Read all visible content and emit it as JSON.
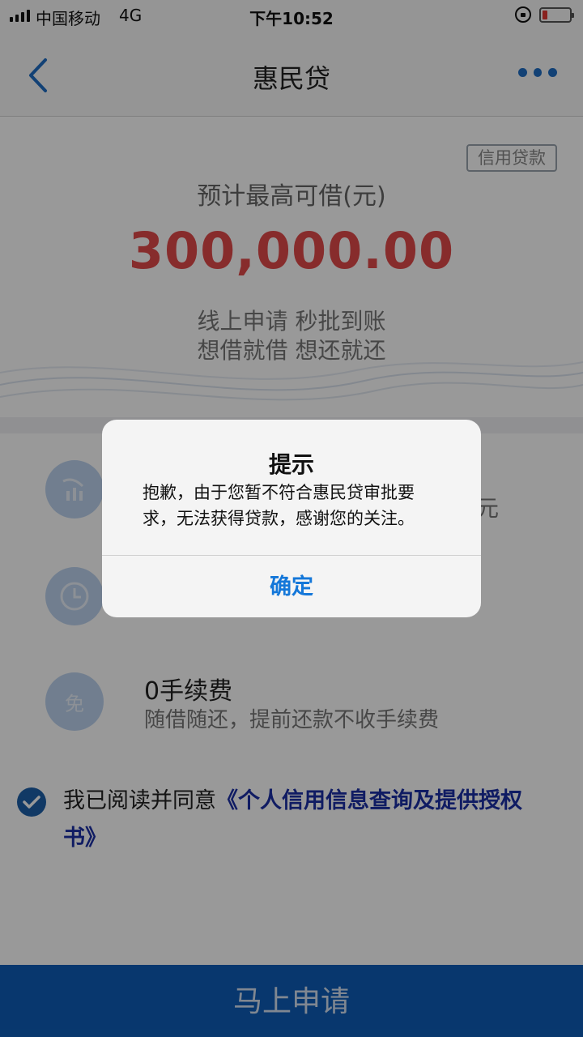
{
  "status_bar": {
    "carrier": "中国移动",
    "network": "4G",
    "time": "下午10:52"
  },
  "nav": {
    "title": "惠民贷"
  },
  "hero": {
    "badge": "信用贷款",
    "caption": "预计最高可借(元)",
    "amount": "300,000.00",
    "slogan_line1": "线上申请  秒批到账",
    "slogan_line2": "想借就借  想还就还"
  },
  "features": [
    {
      "icon": "chart-icon",
      "title": "",
      "desc": "",
      "suffix": "元"
    },
    {
      "icon": "clock-icon",
      "title": "",
      "desc": ""
    },
    {
      "icon": "free-icon",
      "icon_text": "免",
      "title": "0手续费",
      "desc": "随借随还，提前还款不收手续费"
    }
  ],
  "agreement": {
    "checked": true,
    "text": "我已阅读并同意",
    "link": "《个人信用信息查询及提供授权书》"
  },
  "apply_button": {
    "label": "马上申请"
  },
  "dialog": {
    "title": "提示",
    "message": "抱歉，由于您暂不符合惠民贷审批要求，无法获得贷款，感谢您的关注。",
    "confirm_label": "确定"
  },
  "colors": {
    "accent": "#1477d9",
    "amount": "#e14a4a",
    "apply_button": "#0e5db8"
  }
}
